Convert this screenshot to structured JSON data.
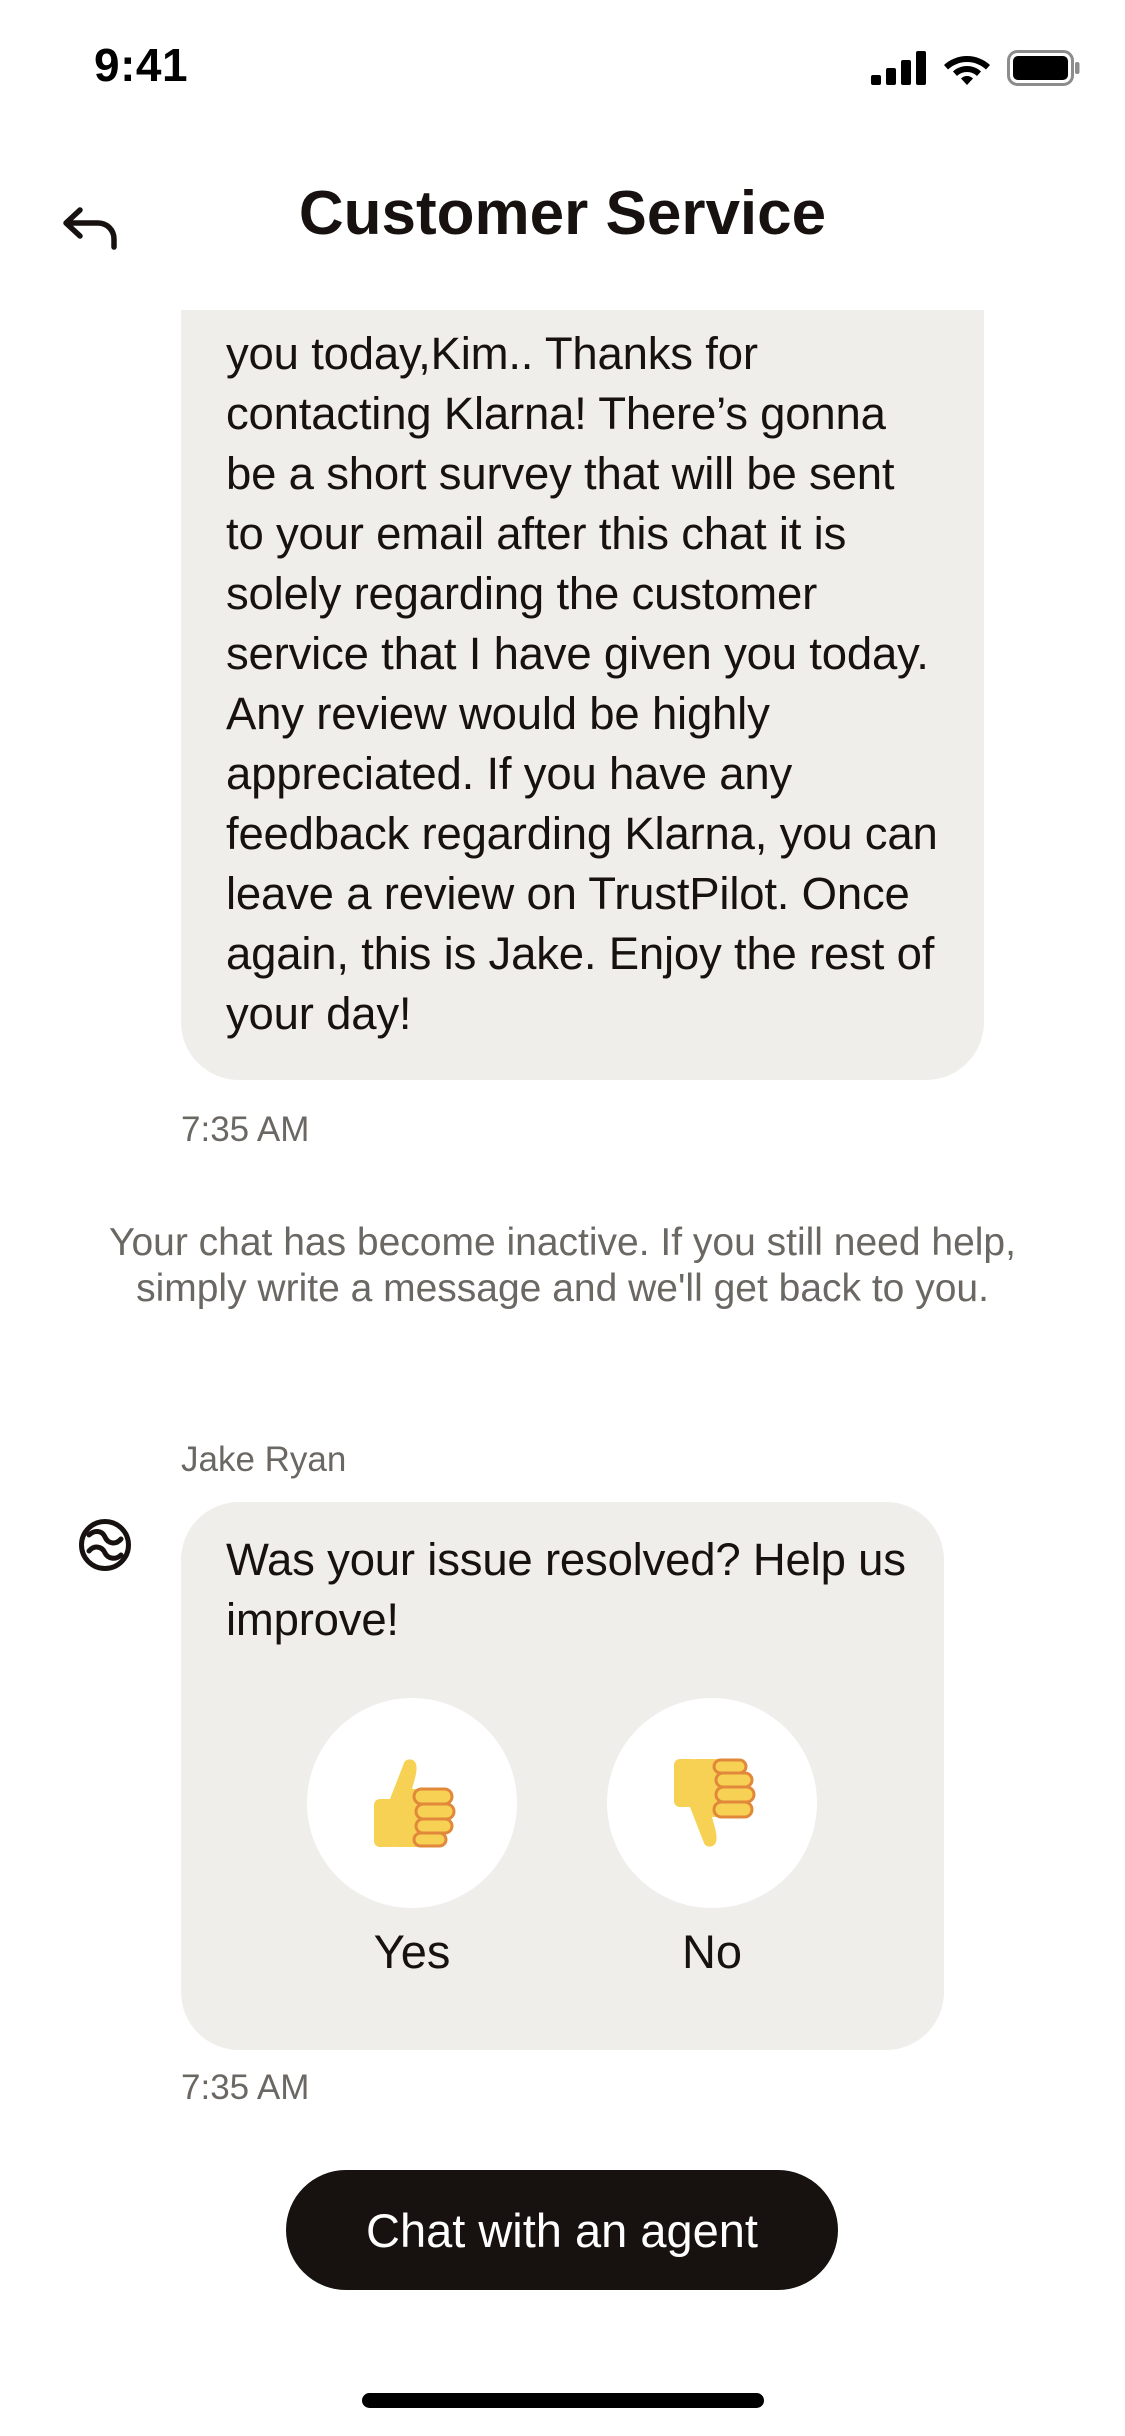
{
  "status_bar": {
    "time": "9:41",
    "icons": [
      "cellular-signal-icon",
      "wifi-icon",
      "battery-icon"
    ]
  },
  "header": {
    "title": "Customer Service",
    "back_icon": "back-arrow-icon"
  },
  "messages": [
    {
      "type": "agent",
      "text": "you today,Kim.. Thanks for contacting Klarna! There’s gonna be a short survey that will be sent to your email after this chat it is solely regarding the customer service that I have given you today. Any review would be highly appreciated. If you have any feedback regarding Klarna, you can leave a review on TrustPilot. Once again, this is Jake. Enjoy the rest of your day!",
      "time": "7:35 AM"
    },
    {
      "type": "system",
      "text": "Your chat has become inactive. If you still need help, simply write a message and we'll get back to you."
    },
    {
      "type": "agent",
      "sender": "Jake Ryan",
      "text": "Was your issue resolved? Help us improve!",
      "time": "7:35 AM",
      "options": [
        {
          "label": "Yes",
          "icon": "thumbs-up-icon"
        },
        {
          "label": "No",
          "icon": "thumbs-down-icon"
        }
      ]
    }
  ],
  "footer": {
    "button_label": "Chat with an agent"
  },
  "colors": {
    "bubble": "#efeeeb",
    "text": "#17120f",
    "muted": "#6b6864",
    "button": "#17120f",
    "thumb": "#f7d154"
  }
}
